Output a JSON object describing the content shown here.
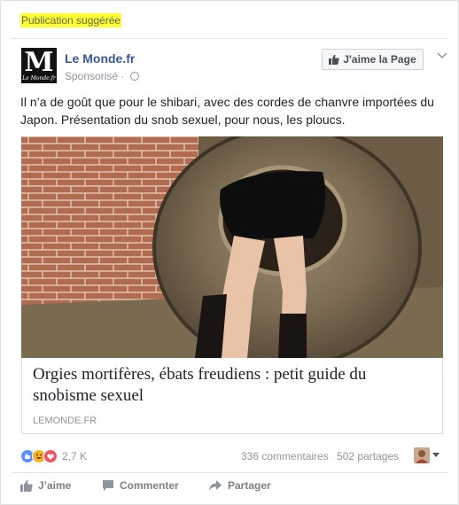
{
  "post": {
    "suggested_label": "Publication suggérée",
    "page_name": "Le Monde.fr",
    "sponsored": "Sponsorisé ·",
    "like_page_label": "J'aime la Page",
    "text": "Il n’a de goût que pour le shibari, avec des cordes de chanvre importées du Japon. Présentation du snob sexuel, pour nous, les ploucs.",
    "link": {
      "title": "Orgies mortifères, ébats freudiens : petit guide du snobisme sexuel",
      "domain": "LEMONDE.FR"
    }
  },
  "logo": {
    "letter": "M",
    "small": "Le Monde.fr"
  },
  "reactions": {
    "count": "2,7 K"
  },
  "stats": {
    "comments": "336 commentaires",
    "shares": "502 partages"
  },
  "actions": {
    "like": "J’aime",
    "comment": "Commenter",
    "share": "Partager"
  },
  "colors": {
    "link_blue": "#365899",
    "highlight": "#ffff2b",
    "like_reaction": "#5890ff",
    "love_reaction": "#f25268",
    "haha_reaction": "#f7b125"
  },
  "icons": [
    "thumbs-up-icon",
    "globe-icon",
    "chevron-down-icon",
    "comment-icon",
    "share-arrow-icon"
  ]
}
